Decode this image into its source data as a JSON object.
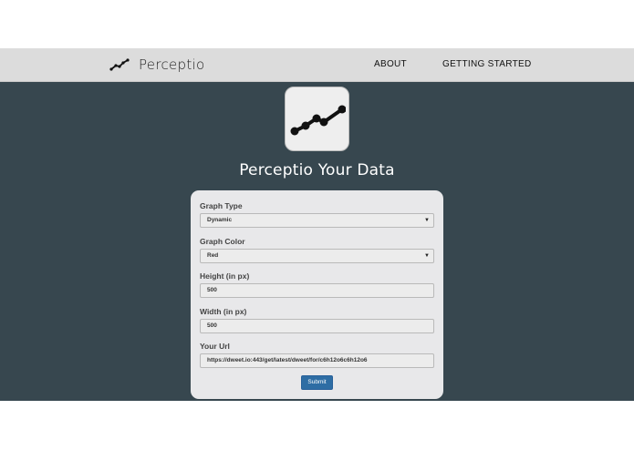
{
  "navbar": {
    "brand_icon": "line-chart-icon",
    "brand_name": "Perceptio",
    "links": [
      {
        "label": "ABOUT"
      },
      {
        "label": "GETTING STARTED"
      }
    ]
  },
  "hero": {
    "logo_icon": "line-chart-icon",
    "title": "Perceptio Your Data"
  },
  "form": {
    "graph_type": {
      "label": "Graph Type",
      "value": "Dynamic"
    },
    "graph_color": {
      "label": "Graph Color",
      "value": "Red"
    },
    "height": {
      "label": "Height (in px)",
      "value": "500"
    },
    "width": {
      "label": "Width (in px)",
      "value": "500"
    },
    "url": {
      "label": "Your Url",
      "value": "https://dweet.io:443/get/latest/dweet/for/c6h12o6c6h12o6"
    },
    "submit_label": "Submit"
  },
  "colors": {
    "navbar_bg": "#dcdcdc",
    "hero_bg": "#37474f",
    "card_bg": "#e8e8ea",
    "button_bg": "#2e6da4"
  }
}
